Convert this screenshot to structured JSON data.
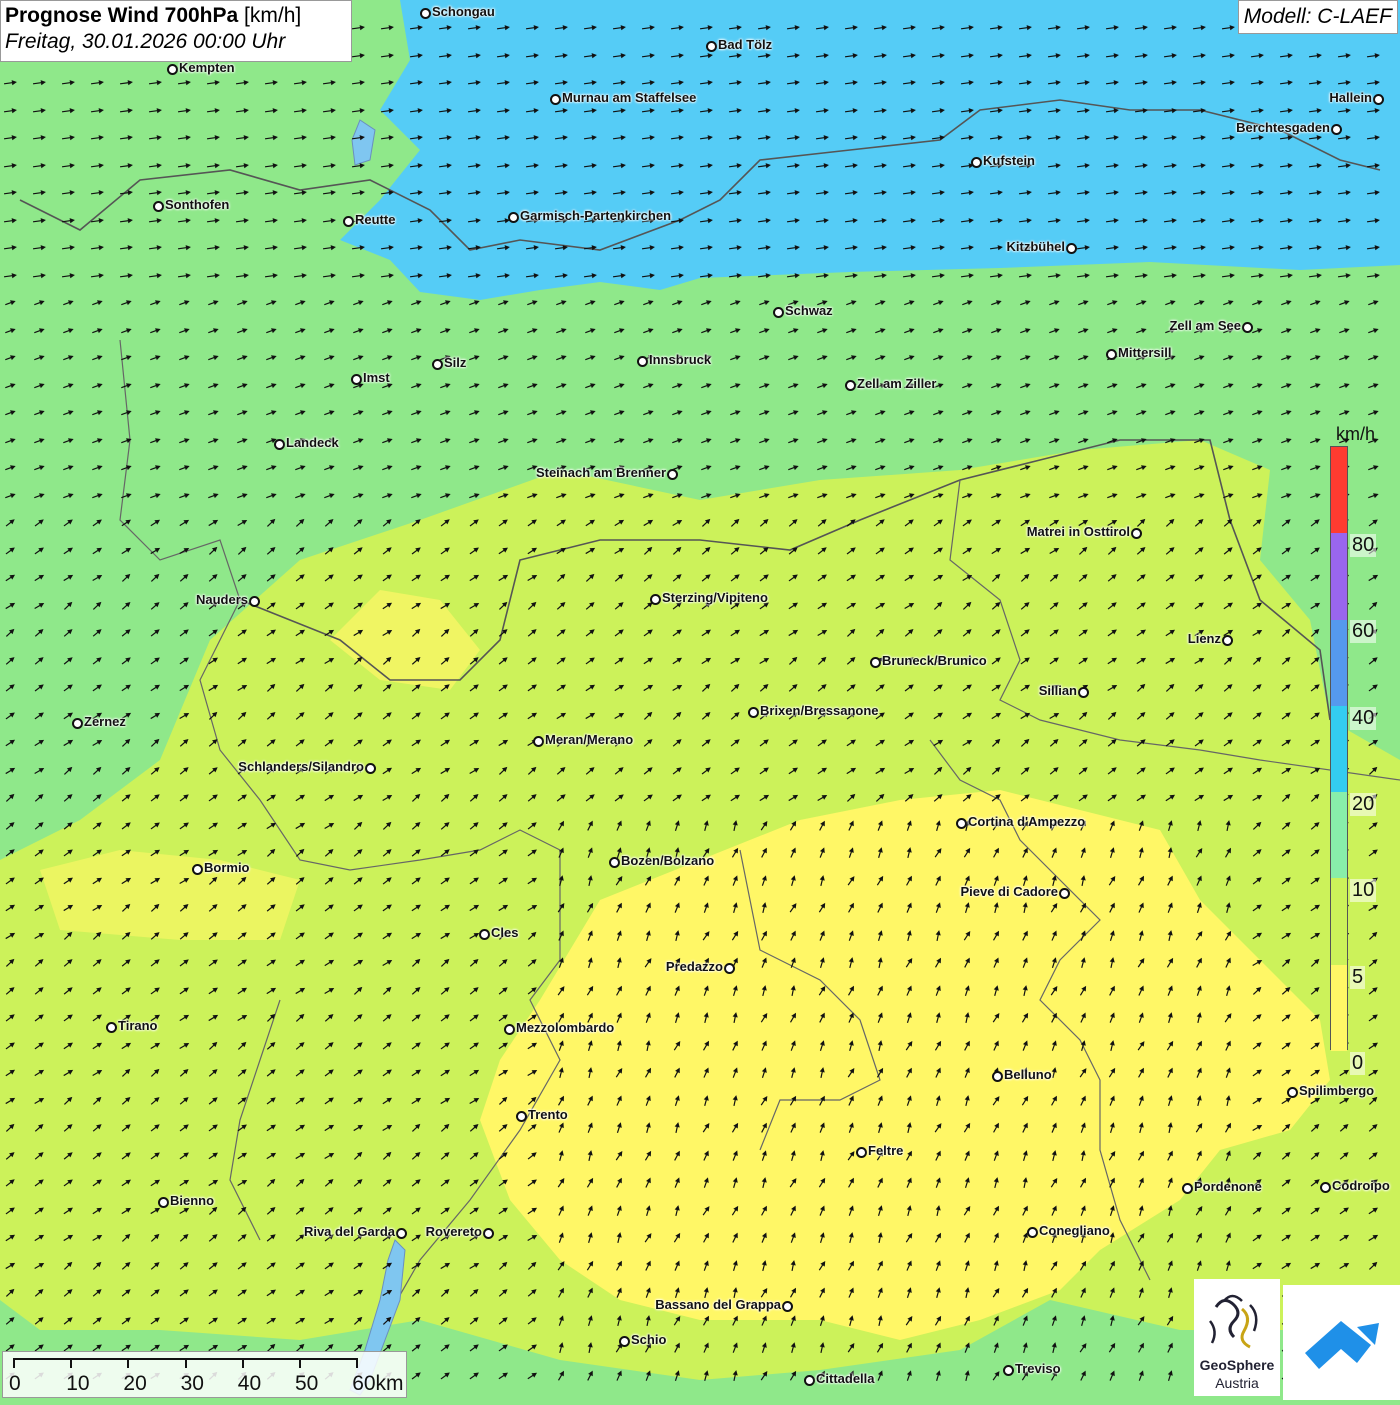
{
  "header": {
    "title_bold": "Prognose Wind 700hPa",
    "title_unit": "[km/h]",
    "datetime": "Freitag, 30.01.2026 00:00 Uhr"
  },
  "model_label": "Modell: C-LAEF",
  "legend": {
    "unit": "km/h",
    "levels": [
      "80",
      "60",
      "40",
      "20",
      "10",
      "5",
      "0"
    ],
    "colors": [
      "#ff3b30",
      "#9966ee",
      "#5599ee",
      "#33ccf0",
      "#88eeaa",
      "#ccf25a",
      "#fff766"
    ]
  },
  "scale_bar": {
    "labels": [
      "0",
      "10",
      "20",
      "30",
      "40",
      "50",
      "60km"
    ]
  },
  "logo": {
    "name_line1": "GeoSphere",
    "name_line2": "Austria"
  },
  "map_colors": {
    "zone_0_5": "#fff766",
    "zone_5_10": "#ccf25a",
    "zone_10_20": "#8fe88a",
    "zone_20_40": "#55ccf6",
    "border": "#555555"
  },
  "wind_direction": "southwest",
  "cities": [
    {
      "name": "Schongau"
    },
    {
      "name": "Kempten"
    },
    {
      "name": "Bad Tölz"
    },
    {
      "name": "Murnau am Staffelsee"
    },
    {
      "name": "Hallein"
    },
    {
      "name": "Berchtesgaden"
    },
    {
      "name": "Kufstein"
    },
    {
      "name": "Sonthofen"
    },
    {
      "name": "Reutte"
    },
    {
      "name": "Garmisch-Partenkirchen"
    },
    {
      "name": "Kitzbühel"
    },
    {
      "name": "Schwaz"
    },
    {
      "name": "Zell am See"
    },
    {
      "name": "Mittersill"
    },
    {
      "name": "Innsbruck"
    },
    {
      "name": "Silz"
    },
    {
      "name": "Imst"
    },
    {
      "name": "Zell am Ziller"
    },
    {
      "name": "Landeck"
    },
    {
      "name": "Steinach am Brenner"
    },
    {
      "name": "Matrei in Osttirol"
    },
    {
      "name": "Nauders"
    },
    {
      "name": "Sterzing/Vipiteno"
    },
    {
      "name": "Lienz"
    },
    {
      "name": "Bruneck/Brunico"
    },
    {
      "name": "Sillian"
    },
    {
      "name": "Brixen/Bressanone"
    },
    {
      "name": "Zernez"
    },
    {
      "name": "Meran/Merano"
    },
    {
      "name": "Schlanders/Silandro"
    },
    {
      "name": "Cortina d'Ampezzo"
    },
    {
      "name": "Bozen/Bolzano"
    },
    {
      "name": "Bormio"
    },
    {
      "name": "Pieve di Cadore"
    },
    {
      "name": "Cles"
    },
    {
      "name": "Predazzo"
    },
    {
      "name": "Tirano"
    },
    {
      "name": "Mezzolombardo"
    },
    {
      "name": "Belluno"
    },
    {
      "name": "Spilimbergo"
    },
    {
      "name": "Trento"
    },
    {
      "name": "Feltre"
    },
    {
      "name": "Pordenone"
    },
    {
      "name": "Codroipo"
    },
    {
      "name": "Bienno"
    },
    {
      "name": "Riva del Garda"
    },
    {
      "name": "Rovereto"
    },
    {
      "name": "Conegliano"
    },
    {
      "name": "Bassano del Grappa"
    },
    {
      "name": "Schio"
    },
    {
      "name": "Treviso"
    },
    {
      "name": "Cittadella"
    }
  ]
}
